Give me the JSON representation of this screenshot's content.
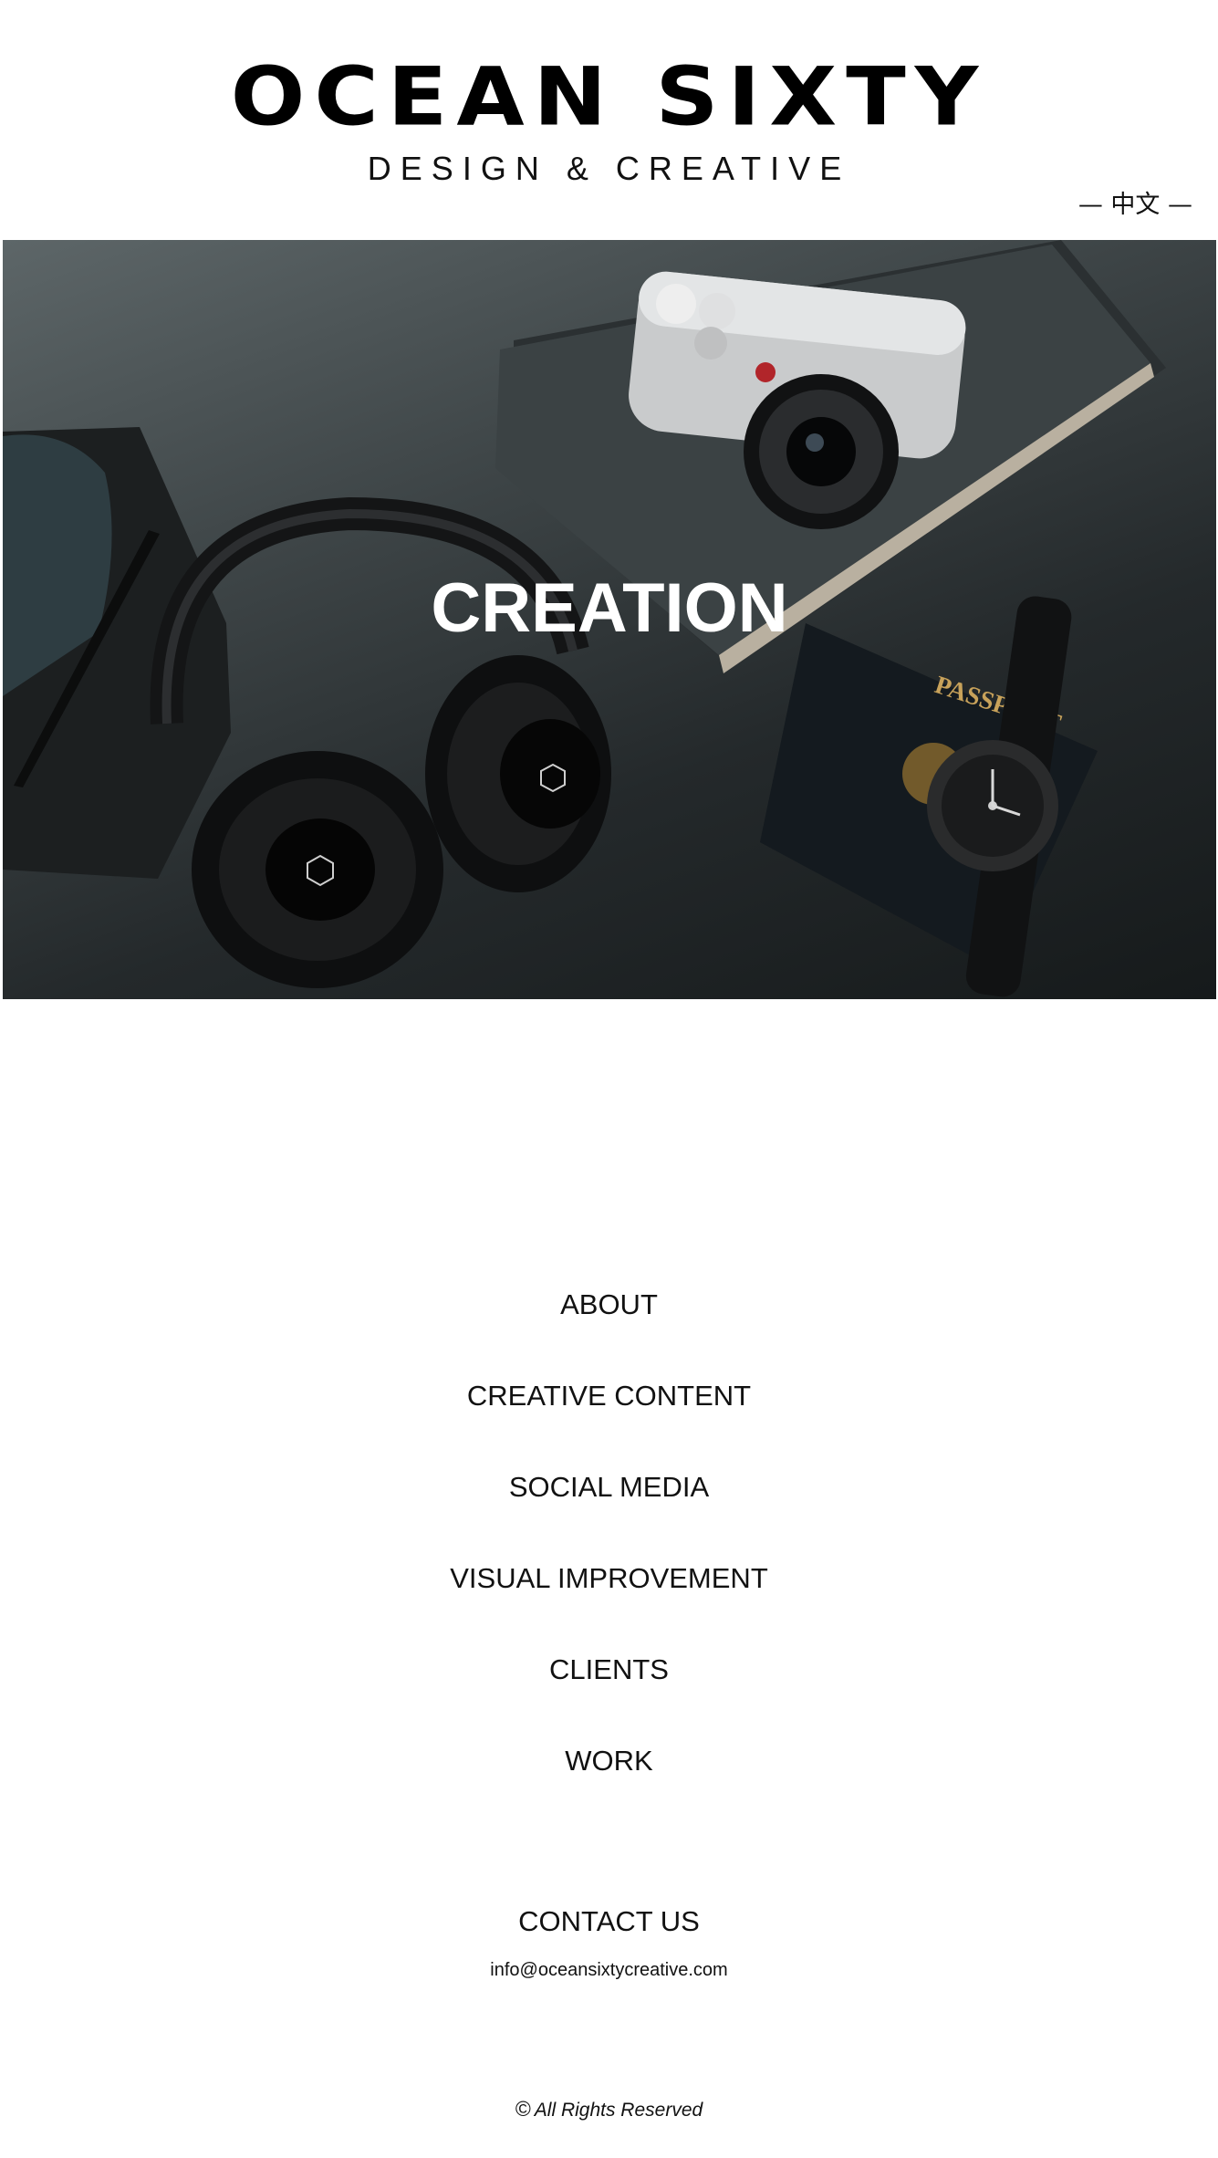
{
  "header": {
    "logo_title": "OCEAN SIXTY",
    "logo_subtitle": "DESIGN & CREATIVE",
    "language_link": "— 中文 —"
  },
  "hero": {
    "title": "CREATION"
  },
  "nav": {
    "items": [
      {
        "label": "ABOUT"
      },
      {
        "label": "CREATIVE CONTENT"
      },
      {
        "label": "SOCIAL MEDIA"
      },
      {
        "label": "VISUAL IMPROVEMENT"
      },
      {
        "label": "CLIENTS"
      },
      {
        "label": "WORK"
      }
    ]
  },
  "contact": {
    "title": "CONTACT US",
    "email": "info@oceansixtycreative.com"
  },
  "footer": {
    "copyright_icon": "©",
    "text": "All Rights Reserved"
  }
}
